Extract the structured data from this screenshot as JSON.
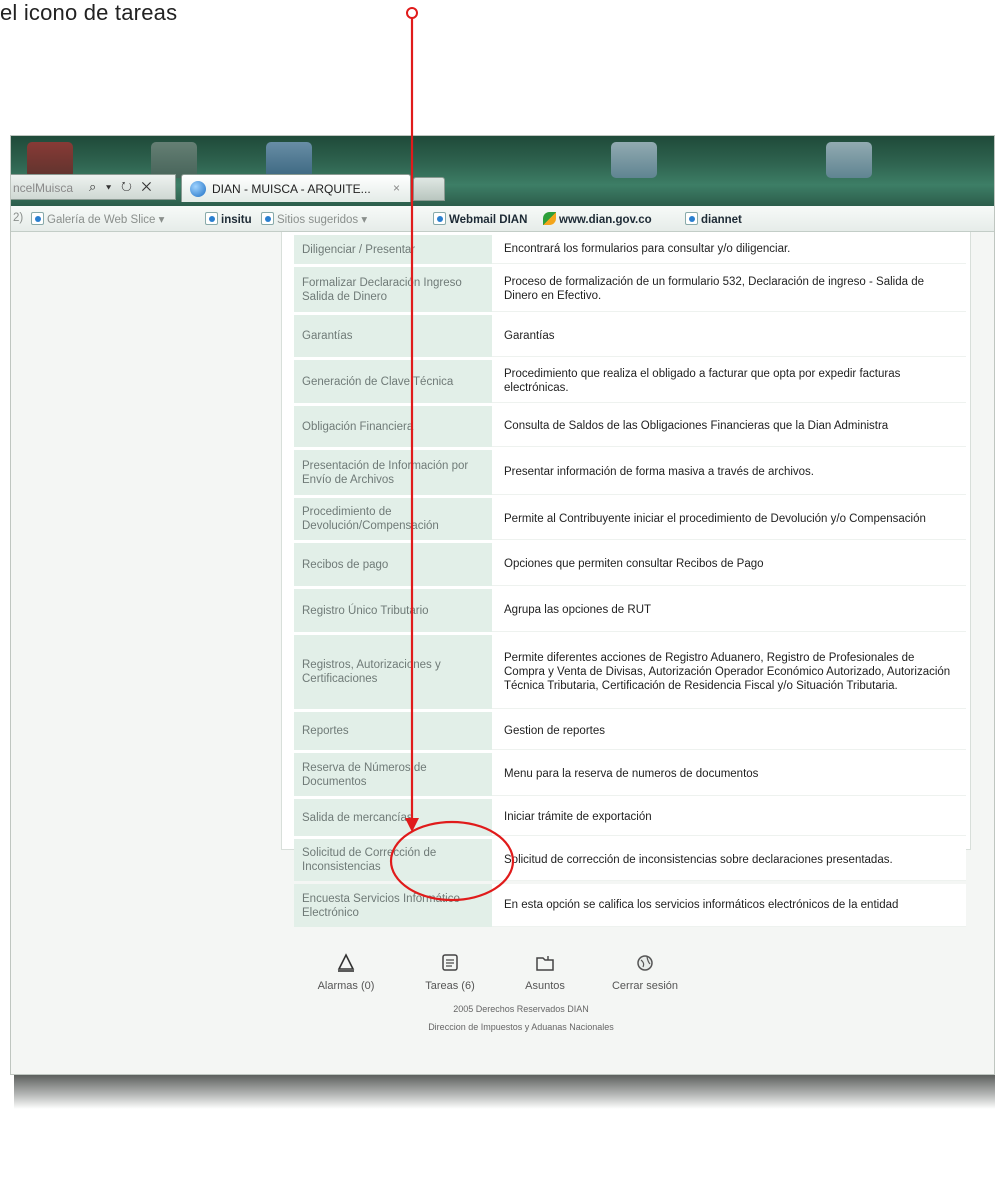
{
  "caption": "el icono de tareas",
  "browser": {
    "address_partial": "ncelMuisca",
    "address_controls": "⌕ ▾ ↻ ✕",
    "tab_title": "DIAN - MUISCA - ARQUITE...",
    "tab_close": "×"
  },
  "favorites": [
    {
      "label": "2)",
      "style": "dim"
    },
    {
      "label": "Galería de Web Slice ▾",
      "style": "dim"
    },
    {
      "label": "insitu",
      "style": "bold"
    },
    {
      "label": "Sitios sugeridos ▾",
      "style": "dim"
    },
    {
      "label": "Webmail DIAN",
      "style": "bold"
    },
    {
      "label": "www.dian.gov.co",
      "style": "bold"
    },
    {
      "label": "diannet",
      "style": "bold"
    }
  ],
  "menu_rows": [
    {
      "option": "Diligenciar / Presentar",
      "description": "Encontrará los formularios para consultar y/o diligenciar."
    },
    {
      "option": "Formalizar Declaración Ingreso Salida de Dinero",
      "description": "Proceso de formalización de un formulario 532, Declaración de ingreso - Salida de Dinero en Efectivo."
    },
    {
      "option": "Garantías",
      "description": "Garantías"
    },
    {
      "option": "Generación de Clave Técnica",
      "description": "Procedimiento que realiza el obligado a facturar que opta por expedir facturas electrónicas."
    },
    {
      "option": "Obligación Financiera",
      "description": "Consulta de Saldos de las Obligaciones Financieras que la Dian Administra"
    },
    {
      "option": "Presentación de Información por Envío de Archivos",
      "description": "Presentar información de forma masiva a través de archivos."
    },
    {
      "option": "Procedimiento de Devolución/Compensación",
      "description": "Permite al Contribuyente iniciar el procedimiento de Devolución y/o Compensación"
    },
    {
      "option": "Recibos de pago",
      "description": "Opciones que permiten consultar Recibos de Pago"
    },
    {
      "option": "Registro Único Tributario",
      "description": "Agrupa las opciones de RUT"
    },
    {
      "option": "Registros, Autorizaciones y Certificaciones",
      "description": "Permite diferentes acciones de Registro Aduanero, Registro de Profesionales de Compra y Venta de Divisas, Autorización Operador Económico Autorizado, Autorización Técnica Tributaria, Certificación de Residencia Fiscal y/o Situación Tributaria."
    },
    {
      "option": "Reportes",
      "description": "Gestion de reportes"
    },
    {
      "option": "Reserva de Números de Documentos",
      "description": "Menu para la reserva de numeros de documentos"
    },
    {
      "option": "Salida de mercancías",
      "description": "Iniciar trámite de exportación"
    },
    {
      "option": "Solicitud de Corrección de Inconsistencias",
      "description": "Solicitud de corrección de inconsistencias sobre declaraciones presentadas."
    },
    {
      "option": "Encuesta Servicios Informático Electrónico",
      "description": "En esta opción se califica los servicios informáticos electrónicos de la entidad"
    }
  ],
  "footer": {
    "alarmas": {
      "label": "Alarmas (0)",
      "icon": "bell-icon"
    },
    "tareas": {
      "label": "Tareas (6)",
      "icon": "tasks-scroll-icon"
    },
    "asuntos": {
      "label": "Asuntos",
      "icon": "folder-icon"
    },
    "cerrar": {
      "label": "Cerrar sesión",
      "icon": "globe-logout-icon"
    },
    "copyright": "2005 Derechos Reservados DIAN",
    "entity": "Direccion de Impuestos y Aduanas Nacionales"
  },
  "colors": {
    "annotation": "#e01b1b",
    "option_cell": "#e2efe8",
    "taskbar": "#2f6450"
  }
}
